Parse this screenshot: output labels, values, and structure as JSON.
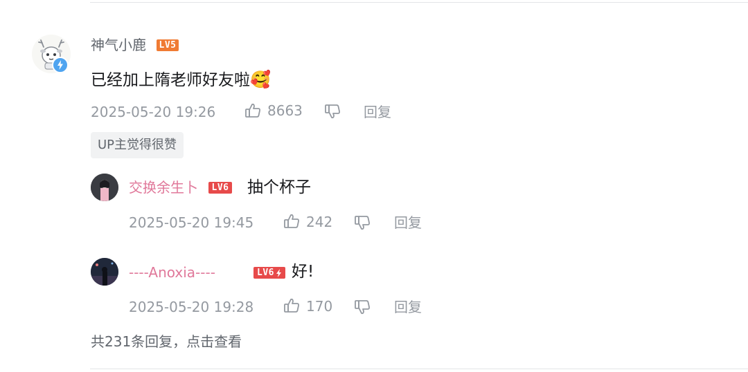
{
  "main_comment": {
    "username": "神气小鹿",
    "level": "LV5",
    "content": "已经加上隋老师好友啦",
    "emoji": "🥰",
    "time": "2025-05-20 19:26",
    "likes": "8663",
    "reply_label": "回复",
    "up_tag": "UP主觉得很赞"
  },
  "replies": [
    {
      "username": "交换余生卜",
      "level": "LV6",
      "content": "抽个杯子",
      "time": "2025-05-20 19:45",
      "likes": "242",
      "reply_label": "回复"
    },
    {
      "username": "----Anoxia----",
      "level": "LV6",
      "content": "好!",
      "time": "2025-05-20 19:28",
      "likes": "170",
      "reply_label": "回复"
    }
  ],
  "more_replies": "共231条回复，点击查看",
  "colors": {
    "vip_pink": "#e0789a",
    "username_gray": "#61666d",
    "lv5": "#f07b33",
    "lv6": "#e74a4a",
    "verify_blue": "#4fa4f0"
  },
  "icons": [
    "thumb-up-icon",
    "thumb-down-icon",
    "lightning-verify-icon",
    "hardcore-lightning-icon"
  ]
}
